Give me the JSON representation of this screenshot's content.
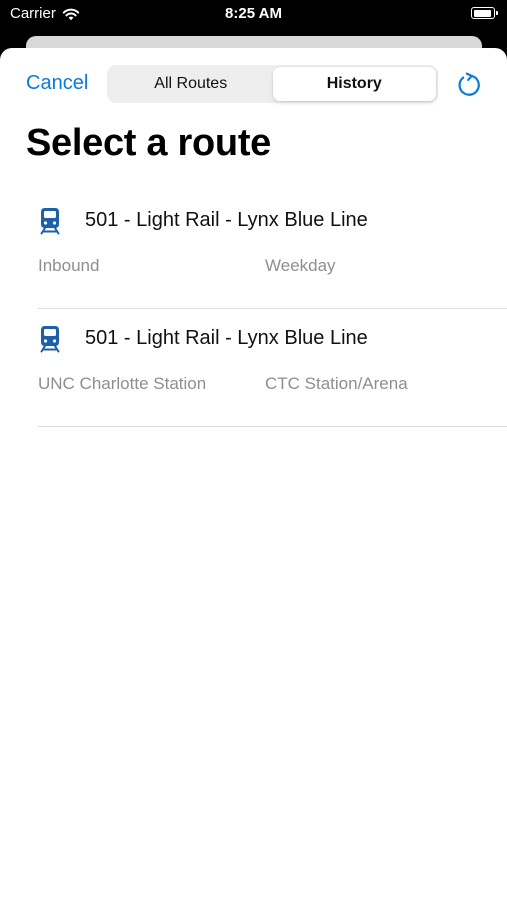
{
  "status_bar": {
    "carrier": "Carrier",
    "time": "8:25 AM"
  },
  "header": {
    "cancel_label": "Cancel",
    "tabs": [
      {
        "label": "All Routes",
        "selected": false
      },
      {
        "label": "History",
        "selected": true
      }
    ],
    "refresh_icon": "refresh-icon"
  },
  "page": {
    "title": "Select a route"
  },
  "routes": [
    {
      "icon": "tram-icon",
      "name": "501 - Light Rail - Lynx Blue Line",
      "left_detail": "Inbound",
      "right_detail": "Weekday"
    },
    {
      "icon": "tram-icon",
      "name": "501 - Light Rail - Lynx Blue Line",
      "left_detail": "UNC Charlotte Station",
      "right_detail": "CTC Station/Arena"
    }
  ],
  "colors": {
    "accent": "#0a7bdc",
    "tram_icon": "#1d5fa8",
    "secondary_text": "#8e8e93"
  }
}
